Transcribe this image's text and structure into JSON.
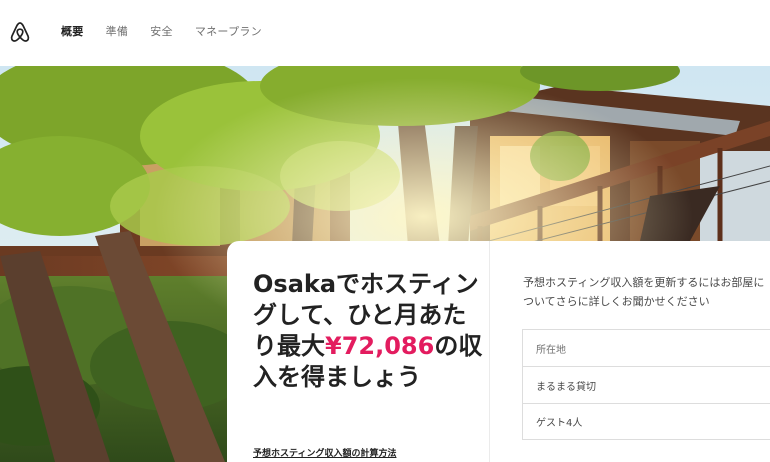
{
  "nav": {
    "items": [
      {
        "label": "概要",
        "active": true
      },
      {
        "label": "準備",
        "active": false
      },
      {
        "label": "安全",
        "active": false
      },
      {
        "label": "マネープラン",
        "active": false
      }
    ]
  },
  "logo": {
    "icon": "airbnb-logo-icon"
  },
  "hero": {
    "image": "treehouse-with-trees-photo"
  },
  "card": {
    "headline_pre": "Osakaでホスティングして、ひと月あたり最大",
    "headline_amount": "¥72,086",
    "headline_post": "の収入を得ましょう",
    "calc_link": "予想ホスティング収入額の計算方法",
    "prompt": "予想ホスティング収入額を更新するにはお部屋についてさらに詳しくお聞かせください",
    "fields": {
      "location_placeholder": "所在地",
      "type_value": "まるまる貸切",
      "guests_value": "ゲスト4人"
    }
  },
  "colors": {
    "accent": "#E31C5F",
    "text": "#222222"
  }
}
